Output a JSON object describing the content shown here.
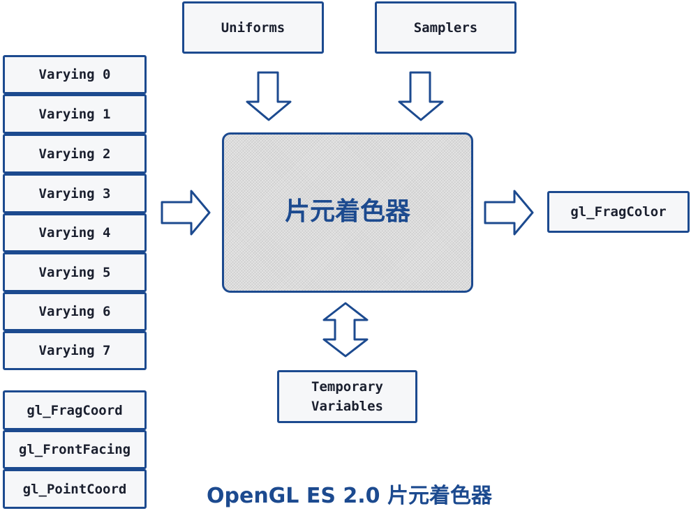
{
  "inputs": {
    "uniforms": "Uniforms",
    "samplers": "Samplers"
  },
  "varyings": [
    "Varying 0",
    "Varying 1",
    "Varying 2",
    "Varying 3",
    "Varying 4",
    "Varying 5",
    "Varying 6",
    "Varying 7"
  ],
  "builtins": [
    "gl_FragCoord",
    "gl_FrontFacing",
    "gl_PointCoord"
  ],
  "shader": {
    "label": "片元着色器"
  },
  "output": {
    "label": "gl_FragColor"
  },
  "temporary": {
    "line1": "Temporary",
    "line2": "Variables"
  },
  "caption": "OpenGL ES 2.0 片元着色器",
  "colors": {
    "stroke": "#1c4a8f",
    "box_fill": "#f6f7f9",
    "shader_fill": "#dcdcdc"
  }
}
